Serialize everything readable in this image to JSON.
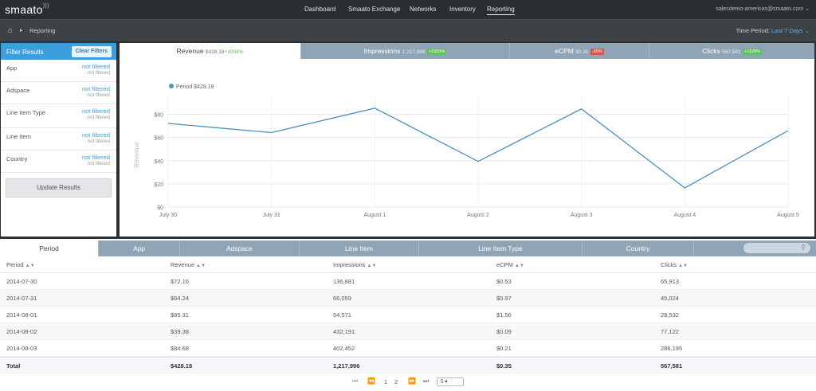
{
  "app": {
    "logo": "smaato",
    "user": "salesdemo-americas@smaato.com"
  },
  "nav": {
    "items": [
      {
        "label": "Dashboard",
        "active": false
      },
      {
        "label": "Smaato Exchange",
        "active": false
      },
      {
        "label": "Networks",
        "active": false
      },
      {
        "label": "Inventory",
        "active": false
      },
      {
        "label": "Reporting",
        "active": true
      }
    ]
  },
  "subheader": {
    "breadcrumb": "Reporting",
    "time_label": "Time Period:",
    "time_value": "Last 7 Days"
  },
  "filters": {
    "title": "Filter Results",
    "clear_label": "Clear Filters",
    "update_label": "Update Results",
    "rows": [
      {
        "label": "App",
        "value": "not filtered",
        "sub": "not filtered"
      },
      {
        "label": "Adspace",
        "value": "not filtered",
        "sub": "not filtered"
      },
      {
        "label": "Line Item Type",
        "value": "not filtered",
        "sub": "not filtered"
      },
      {
        "label": "Line Item",
        "value": "not filtered",
        "sub": "not filtered"
      },
      {
        "label": "Country",
        "value": "not filtered",
        "sub": "not filtered"
      }
    ]
  },
  "metric_tabs": [
    {
      "label": "Revenue",
      "value": "$428.18",
      "change": "+1004%",
      "trend": "up",
      "active": true
    },
    {
      "label": "Impressions",
      "value": "1,217,996",
      "change": "+1933%",
      "trend": "up",
      "active": false
    },
    {
      "label": "eCPM",
      "value": "$0.35",
      "change": "-65%",
      "trend": "down",
      "active": false
    },
    {
      "label": "Clicks",
      "value": "567,581",
      "change": "+1129%",
      "trend": "up",
      "active": false
    }
  ],
  "chart_data": {
    "type": "line",
    "categories": [
      "July 30",
      "July 31",
      "August 1",
      "August 2",
      "August 3",
      "August 4",
      "August 5"
    ],
    "series": [
      {
        "name": "Period $428.18",
        "values": [
          72.16,
          64.24,
          85.31,
          39.38,
          84.68,
          16.5,
          65.9
        ]
      }
    ],
    "ylabel": "Revenue",
    "yticks": [
      "$0",
      "$20",
      "$40",
      "$60",
      "$80"
    ],
    "ylim": [
      0,
      90
    ],
    "grid": true,
    "legend": "top-left",
    "color": "#4a90c4"
  },
  "table_tabs": [
    {
      "label": "Period",
      "active": true
    },
    {
      "label": "App",
      "active": false
    },
    {
      "label": "Adspace",
      "active": false
    },
    {
      "label": "Line Item",
      "active": false
    },
    {
      "label": "Line Item Type",
      "active": false
    },
    {
      "label": "Country",
      "active": false
    }
  ],
  "table": {
    "columns": [
      "Period",
      "Revenue",
      "Impressions",
      "eCPM",
      "Clicks"
    ],
    "rows": [
      [
        "2014-07-30",
        "$72.16",
        "136,681",
        "$0.53",
        "65,913"
      ],
      [
        "2014-07-31",
        "$64.24",
        "66,059",
        "$0.97",
        "45,024"
      ],
      [
        "2014-08-01",
        "$85.31",
        "54,571",
        "$1.56",
        "28,532"
      ],
      [
        "2014-08-02",
        "$39.38",
        "432,191",
        "$0.09",
        "77,122"
      ],
      [
        "2014-08-03",
        "$84.68",
        "402,452",
        "$0.21",
        "286,195"
      ]
    ],
    "total": [
      "Total",
      "$428.18",
      "1,217,996",
      "$0.35",
      "567,581"
    ]
  },
  "pager": {
    "pages": [
      "1",
      "2"
    ],
    "page_size": "5"
  }
}
